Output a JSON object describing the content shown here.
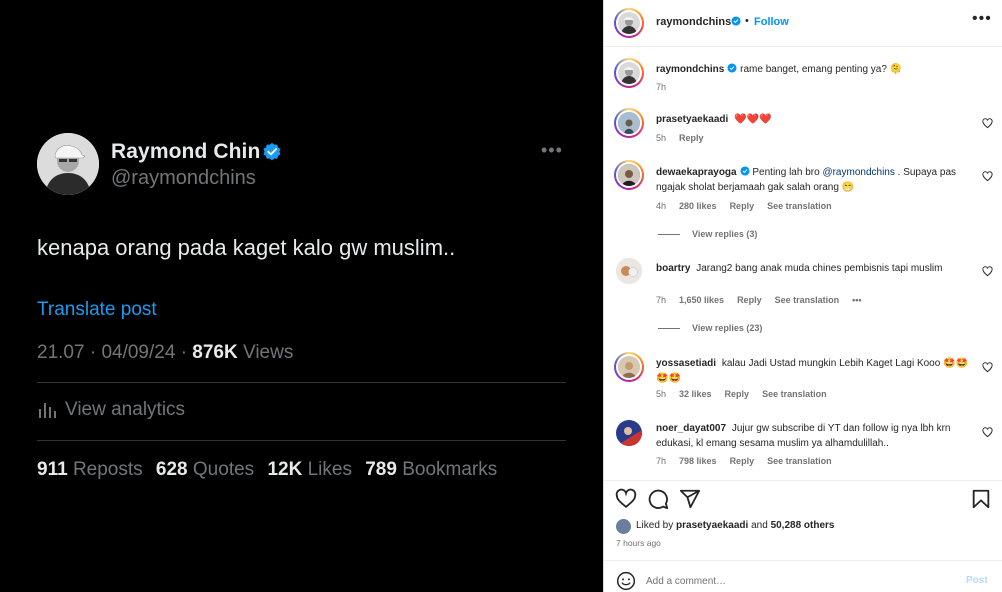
{
  "tweet": {
    "name": "Raymond Chin",
    "handle": "@raymondchins",
    "text": "kenapa orang pada kaget kalo gw muslim..",
    "translate_label": "Translate post",
    "time": "21.07",
    "sep": "·",
    "date": "04/09/24",
    "views_count": "876K",
    "views_label": "Views",
    "analytics_label": "View analytics",
    "stats": [
      {
        "count": "911",
        "label": "Reposts"
      },
      {
        "count": "628",
        "label": "Quotes"
      },
      {
        "count": "12K",
        "label": "Likes"
      },
      {
        "count": "789",
        "label": "Bookmarks"
      }
    ]
  },
  "instagram": {
    "header": {
      "username": "raymondchins",
      "dot": "•",
      "follow_label": "Follow"
    },
    "caption": {
      "username": "raymondchins",
      "text": "rame banget, emang penting ya? 🫠",
      "time": "7h"
    },
    "comments": [
      {
        "username": "prasetyaekaadi",
        "text": "❤️❤️❤️",
        "time": "5h",
        "likes": "",
        "reply": "Reply",
        "see_translation": ""
      },
      {
        "username": "dewaekaprayoga",
        "text_before": "Penting lah bro ",
        "mention": "@raymondchins",
        "text_after": " . Supaya pas ngajak sholat berjamaah gak salah orang 😁",
        "time": "4h",
        "likes": "280 likes",
        "reply": "Reply",
        "see_translation": "See translation",
        "view_replies": "View replies (3)"
      },
      {
        "username": "boartry",
        "text": "Jarang2 bang anak muda chines pembisnis tapi muslim",
        "time": "7h",
        "likes": "1,650 likes",
        "reply": "Reply",
        "see_translation": "See translation",
        "more": "•••",
        "view_replies": "View replies (23)"
      },
      {
        "username": "yossasetiadi",
        "text": "kalau Jadi Ustad mungkin Lebih Kaget Lagi Kooo 🤩🤩🤩🤩",
        "time": "5h",
        "likes": "32 likes",
        "reply": "Reply",
        "see_translation": "See translation"
      },
      {
        "username": "noer_dayat007",
        "text": "Jujur gw subscribe di YT dan follow ig nya lbh krn edukasi, kl emang sesama muslim ya alhamdulillah..",
        "time": "7h",
        "likes": "798 likes",
        "reply": "Reply",
        "see_translation": "See translation"
      }
    ],
    "likes_line": {
      "prefix": "Liked by ",
      "user": "prasetyaekaadi",
      "middle": " and ",
      "count": "50,288 others"
    },
    "posted_time": "7 hours ago",
    "add_comment_placeholder": "Add a comment…",
    "post_label": "Post"
  },
  "colors": {
    "twitter_bg": "#000000",
    "twitter_blue": "#1d9bf0",
    "ig_blue": "#0095f6"
  }
}
